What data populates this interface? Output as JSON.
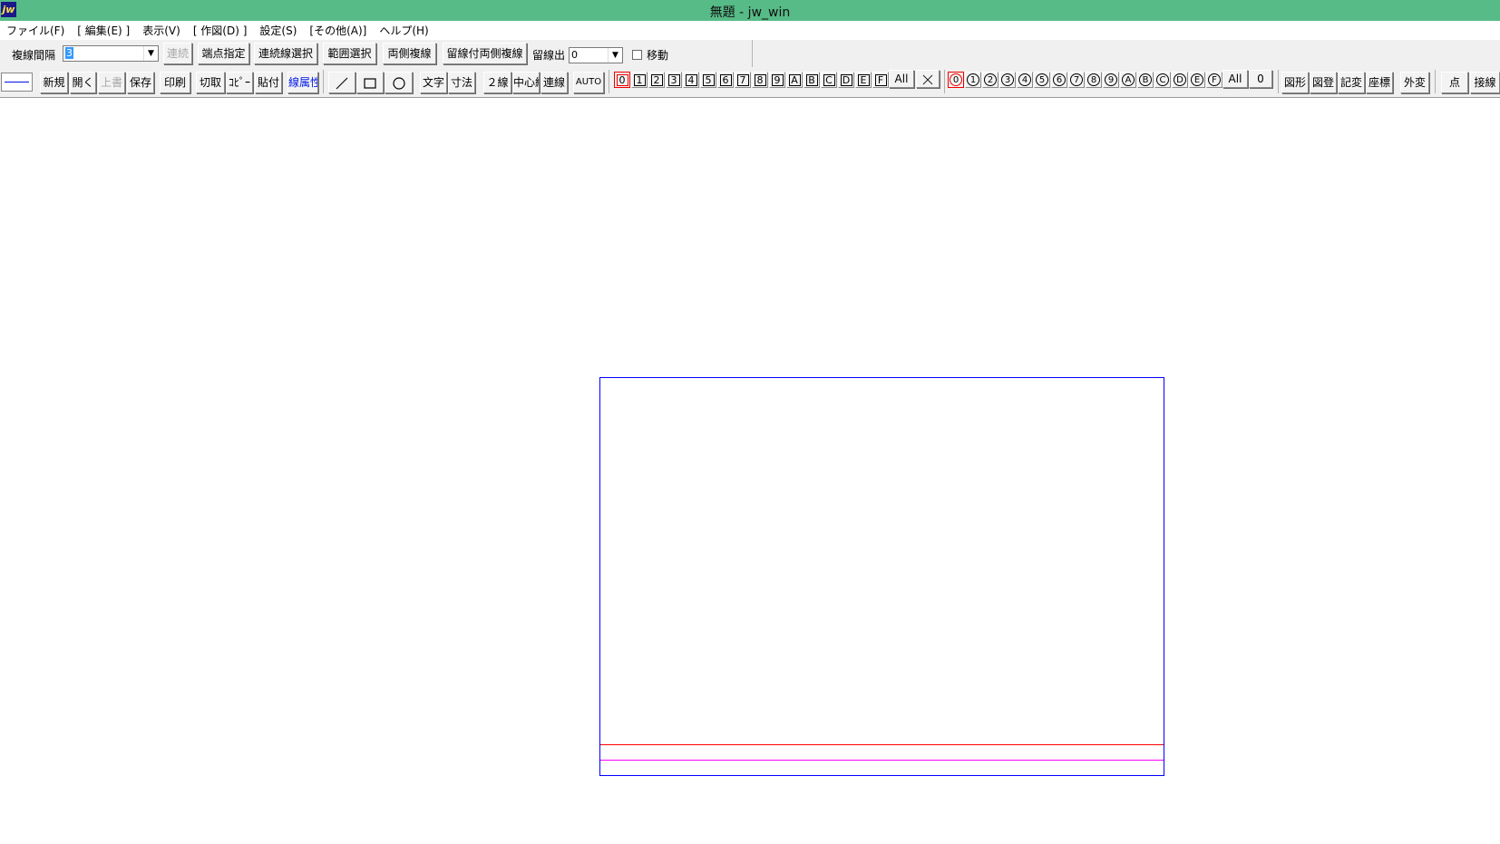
{
  "title": {
    "text": "無題 - jw_win",
    "icon_label": "jw",
    "bar_color": "#57bb87"
  },
  "menu": [
    "ファイル(F)",
    "[ 編集(E) ]",
    "表示(V)",
    "[ 作図(D) ]",
    "設定(S)",
    "[その他(A)]",
    "ヘルプ(H)"
  ],
  "control_bar": {
    "spacing_label": "複線間隔",
    "spacing_value": "3",
    "continuous": "連続",
    "endpoint": "端点指定",
    "chain_select": "連続線選択",
    "range_select": "範囲選択",
    "both_sides": "両側複線",
    "stop_both_sides": "留線付両側複線",
    "stop_out_label": "留線出",
    "stop_out_value": "0",
    "move_label": "移動",
    "move_checked": false
  },
  "toolbar": {
    "new": "新規",
    "open": "開く",
    "overwrite": "上書",
    "save": "保存",
    "print": "印刷",
    "cut": "切取",
    "copy": "ｺﾋﾟｰ",
    "paste": "貼付",
    "line_attr": "線属性",
    "text": "文字",
    "dimension": "寸法",
    "double_line": "２線",
    "center_line": "中心線",
    "connect_line": "連線",
    "auto": "AUTO",
    "shape": "図形",
    "register": "図登",
    "record": "記変",
    "coords": "座標",
    "external": "外変",
    "point": "点",
    "tangent": "接線"
  },
  "layers": {
    "items": [
      "0",
      "1",
      "2",
      "3",
      "4",
      "5",
      "6",
      "7",
      "8",
      "9",
      "A",
      "B",
      "C",
      "D",
      "E",
      "F"
    ],
    "active": "0",
    "all_label": "All",
    "cross_icon": "×"
  },
  "layer_groups": {
    "items": [
      "0",
      "1",
      "2",
      "3",
      "4",
      "5",
      "6",
      "7",
      "8",
      "9",
      "A",
      "B",
      "C",
      "D",
      "E",
      "F"
    ],
    "active": "0",
    "all_label": "All",
    "zero_label": "0"
  },
  "colors": {
    "sheet_border": "#0000ff",
    "red_line": "#ff0000",
    "magenta_line": "#ff00ff",
    "line_attr_text": "#0018e8"
  }
}
